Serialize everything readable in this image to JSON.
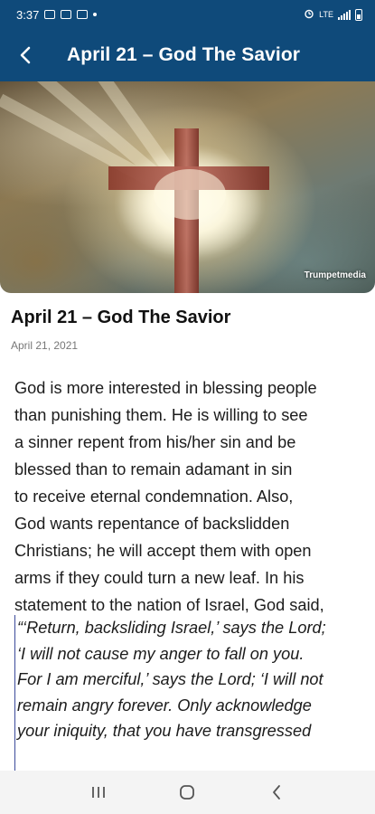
{
  "status_bar": {
    "time": "3:37",
    "network": "LTE"
  },
  "app_bar": {
    "title": "April 21 – God The Savior"
  },
  "hero": {
    "watermark": "Trumpetmedia"
  },
  "post": {
    "title": "April 21 – God The Savior",
    "date": "April 21, 2021",
    "body_lines": [
      "God is more interested in blessing people",
      "than punishing them. He is willing to see",
      "a sinner repent from his/her sin and be",
      "blessed than to remain adamant in sin",
      "to receive eternal condemnation. Also,",
      "God wants repentance of backslidden",
      "Christians; he will accept them with open",
      "arms if they could turn a new leaf. In his",
      "statement to the nation of Israel, God said,"
    ],
    "quote_lines": [
      "“‘Return, backsliding Israel,’ says the Lord;",
      "‘I will not cause my anger to fall on you.",
      "For I am merciful,’ says the Lord; ‘I will not",
      "remain angry forever. Only acknowledge",
      "your iniquity, that you have transgressed"
    ]
  },
  "colors": {
    "app_bar": "#0f4a7a",
    "quote_border": "#3b4a9a"
  }
}
